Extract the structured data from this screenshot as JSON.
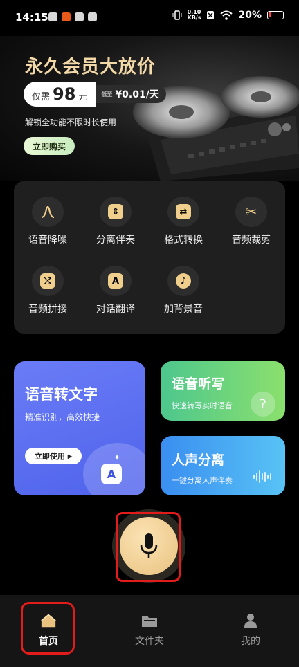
{
  "status_bar": {
    "time": "14:15",
    "net_speed_value": "0.10",
    "net_speed_unit": "KB/s",
    "battery": "20%"
  },
  "banner": {
    "title": "永久会员大放价",
    "price_prefix": "仅需",
    "price": "98",
    "price_unit": "元",
    "low_label": "低至",
    "low_price": "¥0.01/天",
    "subtitle": "解锁全功能不限时长使用",
    "buy_label": "立即购买"
  },
  "tools": [
    {
      "label": "语音降噪",
      "icon": "wave-peak-icon",
      "glyph": "∩"
    },
    {
      "label": "分离伴奏",
      "icon": "split-icon",
      "glyph": "⇕"
    },
    {
      "label": "格式转换",
      "icon": "convert-icon",
      "glyph": "⇄"
    },
    {
      "label": "音频裁剪",
      "icon": "scissors-icon",
      "glyph": "✂"
    },
    {
      "label": "音频拼接",
      "icon": "join-icon",
      "glyph": "⤭"
    },
    {
      "label": "对话翻译",
      "icon": "translate-icon",
      "glyph": "A"
    },
    {
      "label": "加背景音",
      "icon": "music-note-icon",
      "glyph": "♪"
    }
  ],
  "cards": {
    "stt": {
      "title": "语音转文字",
      "desc": "精准识别，高效快捷",
      "button": "立即使用"
    },
    "listen": {
      "title": "语音听写",
      "desc": "快速转写实时语音"
    },
    "separate": {
      "title": "人声分离",
      "desc": "一键分离人声伴奏"
    }
  },
  "nav": {
    "home": "首页",
    "folder": "文件夹",
    "mine": "我的"
  },
  "colors": {
    "accent_gold": "#f0cf8c",
    "highlight_red": "#e21b1b"
  }
}
